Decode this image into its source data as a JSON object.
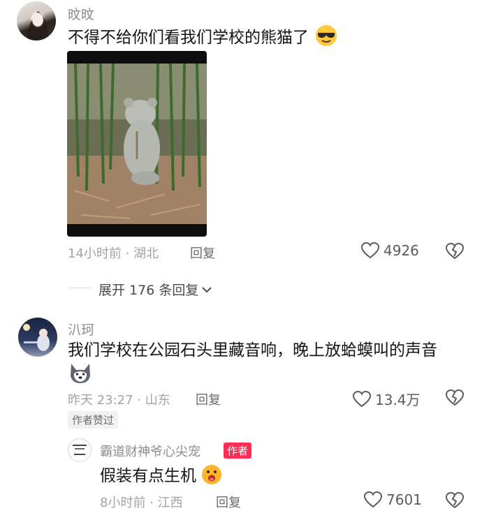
{
  "comments": [
    {
      "username": "旼旼",
      "text": "不得不给你们看我们学校的熊猫了",
      "emoji": "cool-emoji",
      "meta": "14小时前 · 湖北",
      "reply_label": "回复",
      "likes": "4926",
      "expand_label": "展开 176 条回复"
    },
    {
      "username": "汃珂",
      "text": "我们学校在公园石头里藏音响，晚上放蛤蟆叫的声音",
      "emoji": "husky-emoji",
      "meta": "昨天 23:27 · 山东",
      "reply_label": "回复",
      "likes": "13.4万",
      "badge": "作者赞过"
    }
  ],
  "reply": {
    "username": "霸道财神爷心尖宠",
    "author_badge": "作者",
    "text": "假装有点生机",
    "emoji": "shocked-emoji",
    "meta": "8小时前 · 江西",
    "reply_label": "回复",
    "likes": "7601"
  },
  "colors": {
    "author_badge_bg": "#ff2d55",
    "text": "#151515",
    "muted": "#a3a3a3"
  }
}
